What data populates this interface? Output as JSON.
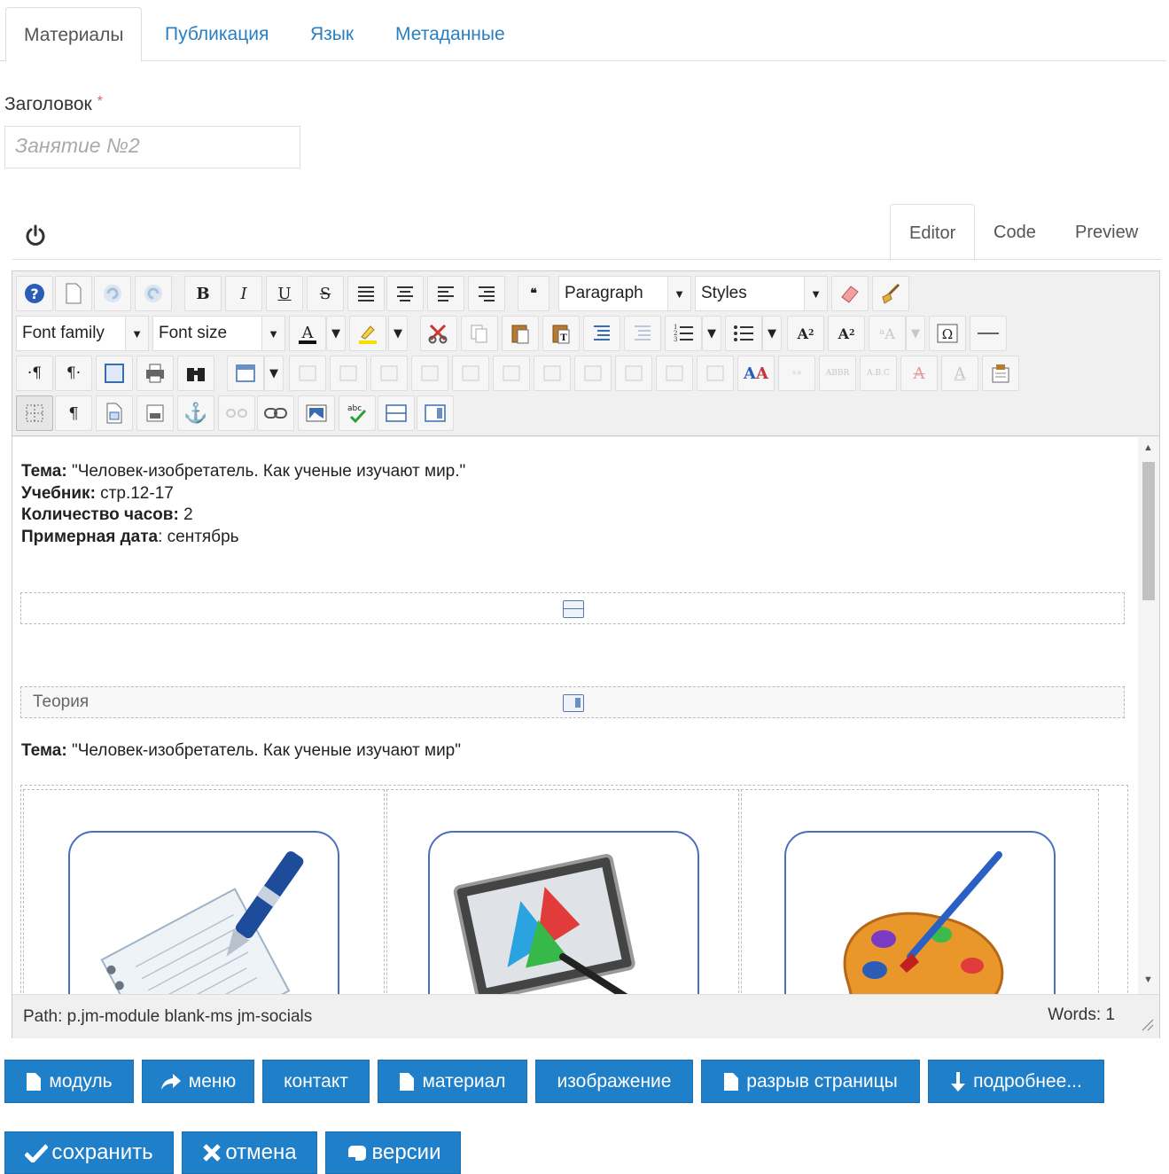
{
  "tabs": [
    {
      "label": "Материалы"
    },
    {
      "label": "Публикация"
    },
    {
      "label": "Язык"
    },
    {
      "label": "Метаданные"
    }
  ],
  "title_field": {
    "label": "Заголовок",
    "required_mark": "*",
    "placeholder": "Занятие №2"
  },
  "editor_tabs": [
    {
      "label": "Editor"
    },
    {
      "label": "Code"
    },
    {
      "label": "Preview"
    }
  ],
  "toolbar": {
    "format_select": "Paragraph",
    "styles_select": "Styles",
    "font_family_select": "Font family",
    "font_size_select": "Font size"
  },
  "content": {
    "line1": {
      "label": "Тема:",
      "text": " \"Человек-изобретатель. Как ученые изучают мир.\""
    },
    "line2": {
      "label": "Учебник:",
      "text": " стр.12-17"
    },
    "line3": {
      "label": "Количество часов:",
      "text": " 2"
    },
    "line4": {
      "label": "Примерная дата",
      "text": ":  сентябрь"
    },
    "readmore_label": "Теория",
    "line5": {
      "label": "Тема:",
      "text": " \"Человек-изобретатель. Как ученые изучают мир\""
    }
  },
  "status": {
    "path_label": "Path:",
    "path_value": "p.jm-module blank-ms jm-socials",
    "words_label": "Words:",
    "words_value": "1"
  },
  "insert_buttons": [
    {
      "label": "модуль",
      "icon": "file-icon"
    },
    {
      "label": "меню",
      "icon": "share-icon"
    },
    {
      "label": "контакт",
      "icon": ""
    },
    {
      "label": "материал",
      "icon": "file-icon"
    },
    {
      "label": "изображение",
      "icon": ""
    },
    {
      "label": "разрыв страницы",
      "icon": "file-icon"
    },
    {
      "label": "подробнее...",
      "icon": "arrow-down-icon"
    }
  ],
  "action_buttons": [
    {
      "label": "сохранить",
      "icon": "check-icon"
    },
    {
      "label": "отмена",
      "icon": "cross-icon"
    },
    {
      "label": "версии",
      "icon": "versions-icon"
    }
  ],
  "colors": {
    "primary": "#1f7fc9",
    "link": "#2a7fc1",
    "card_border": "#4a6fbf"
  }
}
